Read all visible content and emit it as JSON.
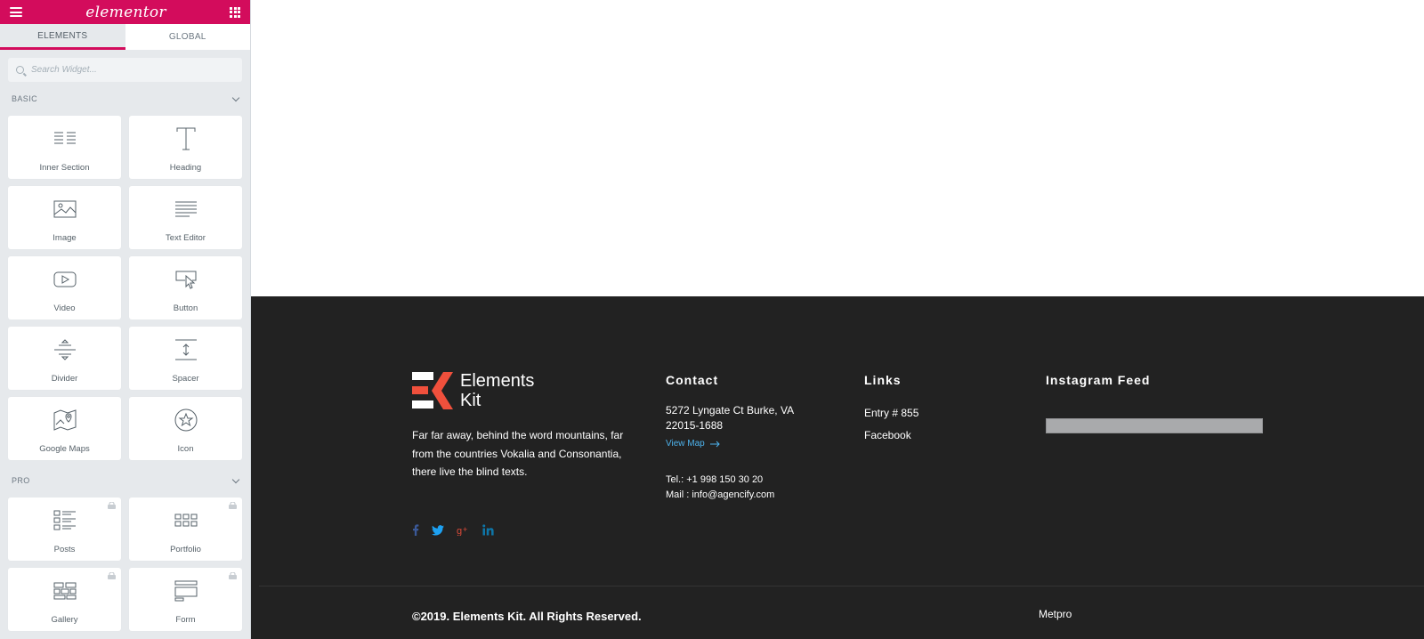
{
  "panel": {
    "logo": "elementor",
    "tabs": [
      {
        "label": "ELEMENTS",
        "active": true
      },
      {
        "label": "GLOBAL",
        "active": false
      }
    ],
    "search_placeholder": "Search Widget...",
    "basic": {
      "title": "BASIC",
      "widgets": [
        {
          "label": "Inner Section",
          "icon": "inner-section-icon"
        },
        {
          "label": "Heading",
          "icon": "heading-icon"
        },
        {
          "label": "Image",
          "icon": "image-icon"
        },
        {
          "label": "Text Editor",
          "icon": "text-editor-icon"
        },
        {
          "label": "Video",
          "icon": "video-icon"
        },
        {
          "label": "Button",
          "icon": "button-icon"
        },
        {
          "label": "Divider",
          "icon": "divider-icon"
        },
        {
          "label": "Spacer",
          "icon": "spacer-icon"
        },
        {
          "label": "Google Maps",
          "icon": "google-maps-icon"
        },
        {
          "label": "Icon",
          "icon": "star-icon"
        }
      ]
    },
    "pro": {
      "title": "PRO",
      "widgets": [
        {
          "label": "Posts",
          "icon": "posts-icon",
          "locked": true
        },
        {
          "label": "Portfolio",
          "icon": "portfolio-icon",
          "locked": true
        },
        {
          "label": "Gallery",
          "icon": "gallery-icon",
          "locked": true
        },
        {
          "label": "Form",
          "icon": "form-icon",
          "locked": true
        }
      ]
    }
  },
  "footer": {
    "brand": {
      "line1": "Elements",
      "line2": "Kit"
    },
    "about": "Far far away, behind the word mountains, far from the countries Vokalia and Consonantia, there live the blind texts.",
    "socials": [
      {
        "name": "facebook",
        "color": "#3b5998"
      },
      {
        "name": "twitter",
        "color": "#1da1f2"
      },
      {
        "name": "google-plus",
        "color": "#dd4b39"
      },
      {
        "name": "linkedin",
        "color": "#0e76a8"
      }
    ],
    "contact": {
      "title": "Contact",
      "address": "5272 Lyngate Ct Burke, VA 22015-1688",
      "view_map": "View Map",
      "phone": "Tel.: +1 998 150 30 20",
      "mail": "Mail : info@agencify.com"
    },
    "links": {
      "title": "Links",
      "items": [
        "Entry # 855",
        "Facebook"
      ]
    },
    "instagram": {
      "title": "Instagram Feed"
    },
    "copyright": "©2019. Elements Kit. All Rights Reserved.",
    "bottom_link": "Metpro"
  },
  "colors": {
    "brand_pink": "#d30c5c",
    "panel_bg": "#e6e9ec",
    "footer_bg": "#222222",
    "link_blue": "#4db2ec",
    "logo_red": "#f0503c"
  }
}
